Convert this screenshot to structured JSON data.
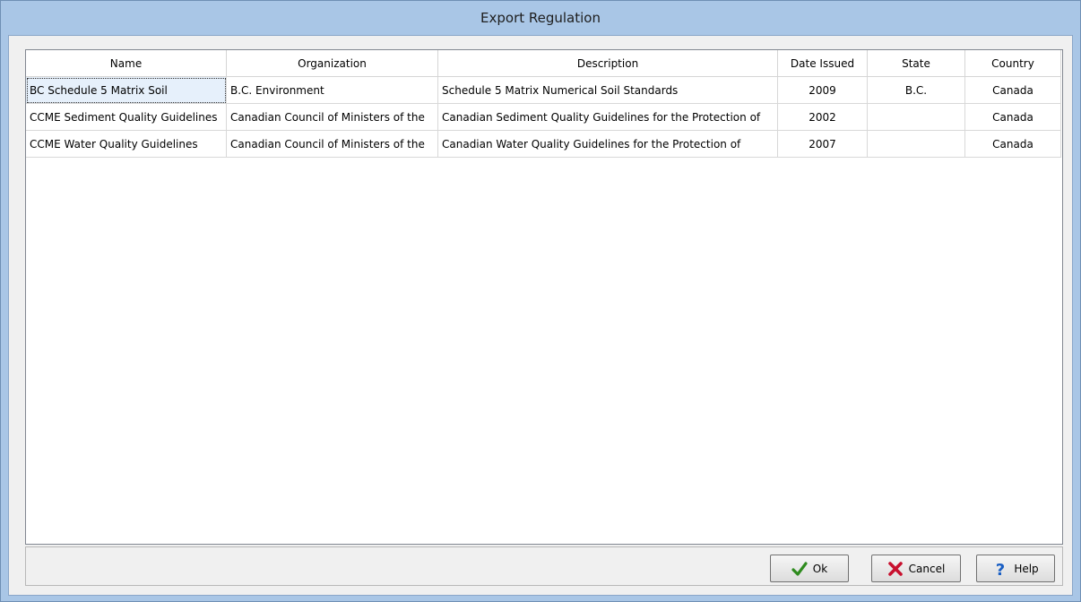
{
  "window": {
    "title": "Export Regulation"
  },
  "grid": {
    "columns": [
      "Name",
      "Organization",
      "Description",
      "Date Issued",
      "State",
      "Country"
    ],
    "rows": [
      [
        "BC Schedule 5 Matrix Soil",
        "B.C. Environment",
        "Schedule 5 Matrix Numerical Soil Standards",
        "2009",
        "B.C.",
        "Canada"
      ],
      [
        "CCME Sediment Quality Guidelines",
        "Canadian Council of Ministers of the",
        "Canadian Sediment Quality Guidelines for the Protection of",
        "2002",
        "",
        "Canada"
      ],
      [
        "CCME Water Quality Guidelines",
        "Canadian Council of Ministers of the",
        "Canadian Water Quality Guidelines for the Protection of",
        "2007",
        "",
        "Canada"
      ]
    ]
  },
  "buttons": {
    "ok": "Ok",
    "cancel": "Cancel",
    "help": "Help"
  },
  "icons": {
    "ok": "checkmark-icon",
    "cancel": "x-icon",
    "help": "question-mark-icon"
  },
  "colors": {
    "checkmark": "#2e8b1e",
    "cancel_x": "#c8102e",
    "help": "#1a5fc4"
  }
}
